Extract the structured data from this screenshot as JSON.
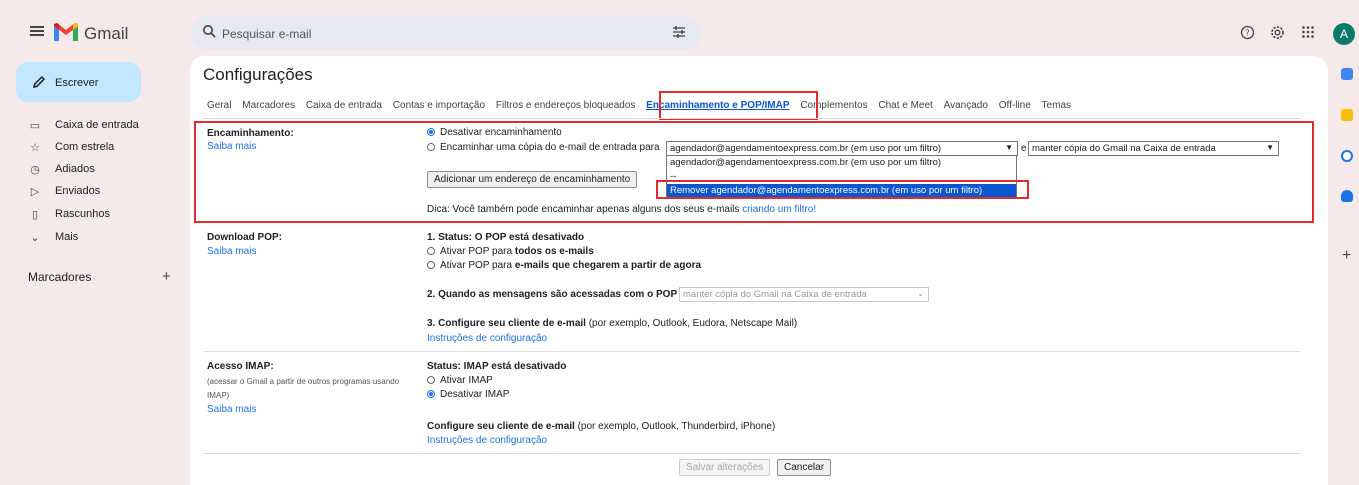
{
  "app": {
    "name": "Gmail"
  },
  "search": {
    "placeholder": "Pesquisar e-mail"
  },
  "header": {
    "avatar_letter": "A"
  },
  "sidebar": {
    "compose_label": "Escrever",
    "items": [
      {
        "label": "Caixa de entrada",
        "icon": "inbox-icon"
      },
      {
        "label": "Com estrela",
        "icon": "star-icon"
      },
      {
        "label": "Adiados",
        "icon": "clock-icon"
      },
      {
        "label": "Enviados",
        "icon": "send-icon"
      },
      {
        "label": "Rascunhos",
        "icon": "draft-icon"
      },
      {
        "label": "Mais",
        "icon": "chevron-down-icon"
      }
    ],
    "labels_title": "Marcadores"
  },
  "settings": {
    "title": "Configurações",
    "tabs": [
      "Geral",
      "Marcadores",
      "Caixa de entrada",
      "Contas e importação",
      "Filtros e endereços bloqueados",
      "Encaminhamento e POP/IMAP",
      "Complementos",
      "Chat e Meet",
      "Avançado",
      "Off-line",
      "Temas"
    ],
    "active_tab": "Encaminhamento e POP/IMAP",
    "forwarding": {
      "label": "Encaminhamento:",
      "learn_more": "Saiba mais",
      "option_disable": "Desativar encaminhamento",
      "option_forward": "Encaminhar uma cópia do e-mail de entrada para",
      "address_selected": "agendador@agendamentoexpress.com.br (em uso por um filtro)",
      "connector": "e",
      "action_selected": "manter cópia do Gmail na Caixa de entrada",
      "dropdown_options": [
        "agendador@agendamentoexpress.com.br (em uso por um filtro)",
        "--",
        "Remover agendador@agendamentoexpress.com.br (em uso por um filtro)"
      ],
      "add_button": "Adicionar um endereço de encaminhamento",
      "tip_text": "Dica: Você também pode encaminhar apenas alguns dos seus e-mails",
      "tip_link": "criando um filtro!"
    },
    "pop": {
      "label": "Download POP:",
      "learn_more": "Saiba mais",
      "status_title": "1. Status: O POP está desativado",
      "opt_all_prefix": "Ativar POP para",
      "opt_all_bold": "todos os e-mails",
      "opt_now_prefix": "Ativar POP para",
      "opt_now_bold": "e-mails que chegarem a partir de agora",
      "step2_title": "2. Quando as mensagens são acessadas com o POP",
      "step2_select": "manter cópia do Gmail na Caixa de entrada",
      "step3_title": "3. Configure seu cliente de e-mail",
      "step3_note": "(por exemplo, Outlook, Eudora, Netscape Mail)",
      "instructions": "Instruções de configuração"
    },
    "imap": {
      "label": "Acesso IMAP:",
      "sub_label_1": "(acessar o Gmail a partir de outros programas usando",
      "sub_label_2": "IMAP)",
      "learn_more": "Saiba mais",
      "status_title": "Status: IMAP está desativado",
      "opt_enable": "Ativar IMAP",
      "opt_disable": "Desativar IMAP",
      "config_title": "Configure seu cliente de e-mail",
      "config_note": "(por exemplo, Outlook, Thunderbird, iPhone)",
      "instructions": "Instruções de configuração"
    },
    "save_button": "Salvar alterações",
    "cancel_button": "Cancelar"
  }
}
